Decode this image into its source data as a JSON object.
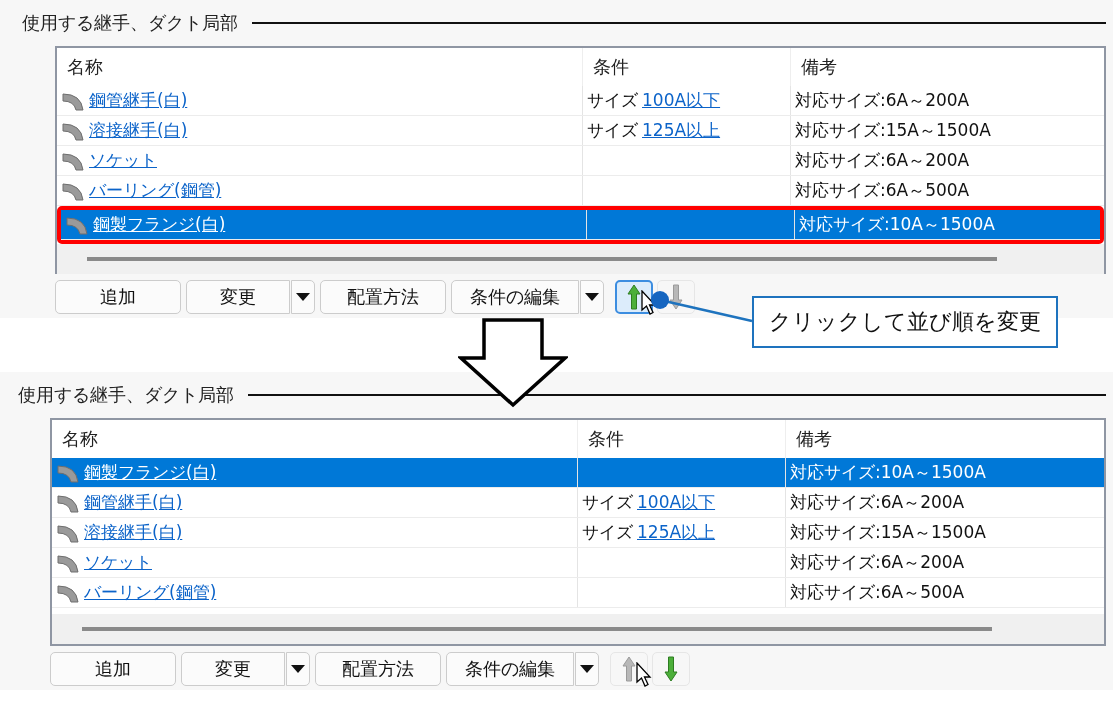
{
  "panels": [
    {
      "title": "使用する継手、ダクト局部",
      "highlight_selected": true,
      "columns": [
        "名称",
        "条件",
        "備考"
      ],
      "rows": [
        {
          "name": "鋼管継手(白)",
          "condition": {
            "label": "サイズ",
            "link": "100A以下"
          },
          "note": "対応サイズ:6A～200A",
          "selected": false
        },
        {
          "name": "溶接継手(白)",
          "condition": {
            "label": "サイズ",
            "link": "125A以上"
          },
          "note": "対応サイズ:15A～1500A",
          "selected": false
        },
        {
          "name": "ソケット",
          "note": "対応サイズ:6A～200A",
          "selected": false
        },
        {
          "name": "バーリング(鋼管)",
          "note": "対応サイズ:6A～500A",
          "selected": false
        },
        {
          "name": "鋼製フランジ(白)",
          "note": "対応サイズ:10A～1500A",
          "selected": true
        }
      ],
      "buttons": [
        {
          "label": "追加",
          "kind": "button"
        },
        {
          "label": "変更",
          "kind": "split"
        },
        {
          "label": "配置方法",
          "kind": "button"
        },
        {
          "label": "条件の編集",
          "kind": "split"
        }
      ],
      "move_up": {
        "disabled": false,
        "hovered": true
      },
      "move_down": {
        "disabled": true,
        "hovered": false
      }
    },
    {
      "title": "使用する継手、ダクト局部",
      "columns": [
        "名称",
        "条件",
        "備考"
      ],
      "rows": [
        {
          "name": "鋼製フランジ(白)",
          "note": "対応サイズ:10A～1500A",
          "selected": true
        },
        {
          "name": "鋼管継手(白)",
          "condition": {
            "label": "サイズ",
            "link": "100A以下"
          },
          "note": "対応サイズ:6A～200A",
          "selected": false
        },
        {
          "name": "溶接継手(白)",
          "condition": {
            "label": "サイズ",
            "link": "125A以上"
          },
          "note": "対応サイズ:15A～1500A",
          "selected": false
        },
        {
          "name": "ソケット",
          "note": "対応サイズ:6A～200A",
          "selected": false
        },
        {
          "name": "バーリング(鋼管)",
          "note": "対応サイズ:6A～500A",
          "selected": false
        }
      ],
      "buttons": [
        {
          "label": "追加",
          "kind": "button"
        },
        {
          "label": "変更",
          "kind": "split"
        },
        {
          "label": "配置方法",
          "kind": "button"
        },
        {
          "label": "条件の編集",
          "kind": "split"
        }
      ],
      "move_up": {
        "disabled": true,
        "hovered": false
      },
      "move_down": {
        "disabled": false,
        "hovered": false
      }
    }
  ],
  "callout": {
    "text": "クリックして並び順を変更"
  }
}
